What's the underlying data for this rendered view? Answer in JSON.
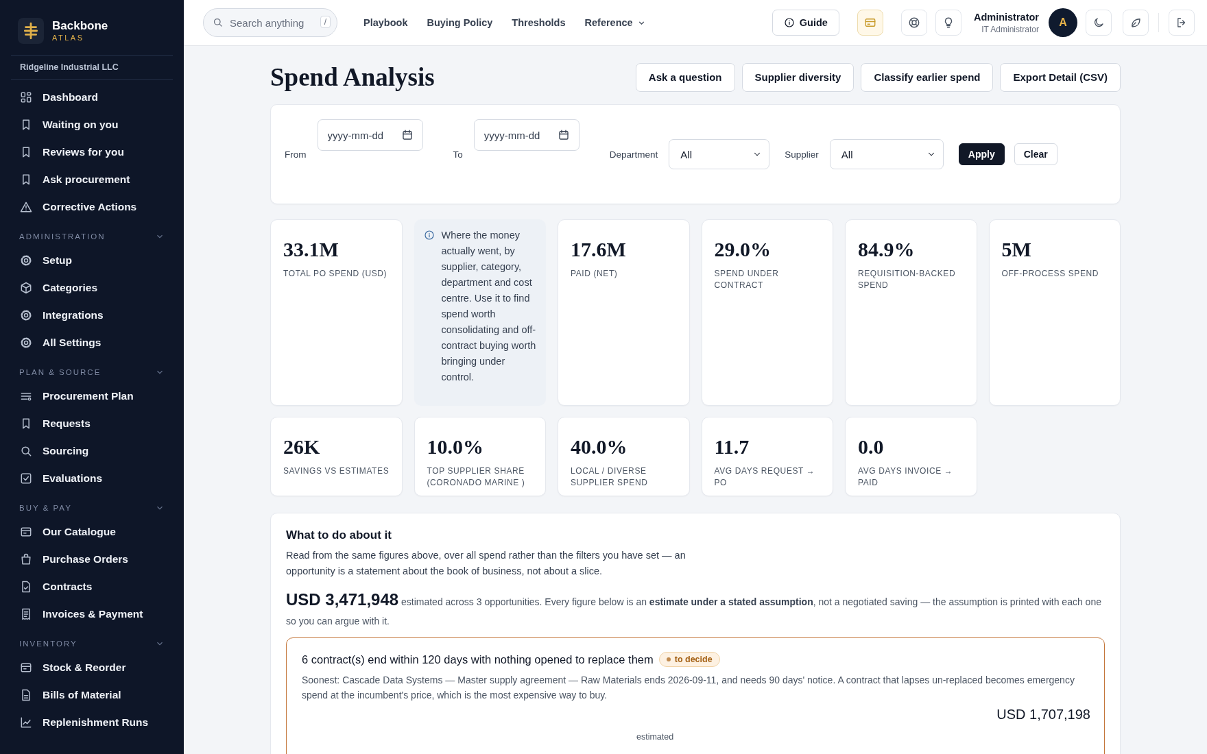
{
  "sidebar": {
    "brand": {
      "name": "Backbone",
      "tagline": "ATLAS"
    },
    "organization": "Ridgeline Industrial LLC",
    "items": [
      "Dashboard",
      "Waiting on you",
      "Reviews for you",
      "Ask procurement",
      "Corrective Actions"
    ],
    "sections": [
      {
        "title": "ADMINISTRATION",
        "expanded": true,
        "items": [
          "Setup",
          "Categories",
          "Integrations",
          "All Settings"
        ]
      },
      {
        "title": "PLAN & SOURCE",
        "expanded": true,
        "items": [
          "Procurement Plan",
          "Requests",
          "Sourcing",
          "Evaluations"
        ]
      },
      {
        "title": "BUY & PAY",
        "expanded": true,
        "items": [
          "Our Catalogue",
          "Purchase Orders",
          "Contracts",
          "Invoices & Payment"
        ]
      },
      {
        "title": "INVENTORY",
        "expanded": true,
        "items": [
          "Stock & Reorder",
          "Bills of Material",
          "Replenishment Runs"
        ]
      }
    ]
  },
  "topbar": {
    "search": {
      "placeholder": "Search anything",
      "shortcut": "/"
    },
    "nav": [
      {
        "label": "Playbook",
        "dropdown": false
      },
      {
        "label": "Buying Policy",
        "dropdown": false
      },
      {
        "label": "Thresholds",
        "dropdown": false
      },
      {
        "label": "Reference",
        "dropdown": true
      }
    ],
    "guide": "Guide",
    "user": {
      "name": "Administrator",
      "role": "IT Administrator",
      "initial": "A"
    }
  },
  "page": {
    "title": "Spend Analysis",
    "actions": [
      "Ask a question",
      "Supplier diversity",
      "Classify earlier spend",
      "Export Detail (CSV)"
    ]
  },
  "filters": {
    "dates": [
      {
        "label": "From",
        "placeholder": "yyyy-mm-dd"
      },
      {
        "label": "To",
        "placeholder": "yyyy-mm-dd"
      }
    ],
    "selects": [
      {
        "label": "Department",
        "value": "All"
      },
      {
        "label": "Supplier",
        "value": "All"
      }
    ],
    "buttons": [
      {
        "label": "Apply",
        "kind": "primary"
      },
      {
        "label": "Clear",
        "kind": "secondary"
      }
    ]
  },
  "stat_rows": [
    {
      "cards": [
        {
          "kind": "stat",
          "value": "33.1M",
          "label": "TOTAL PO SPEND (USD)"
        },
        {
          "kind": "note",
          "text": "Where the money actually went, by supplier, category, department and cost centre. Use it to find spend worth consolidating and off-contract buying worth bringing under control."
        },
        {
          "kind": "stat",
          "value": "17.6M",
          "label": "PAID (NET)"
        },
        {
          "kind": "stat",
          "value": "29.0%",
          "label": "SPEND UNDER CONTRACT"
        },
        {
          "kind": "stat",
          "value": "84.9%",
          "label": "REQUISITION-BACKED SPEND"
        },
        {
          "kind": "stat",
          "value": "5M",
          "label": "OFF-PROCESS SPEND"
        }
      ]
    },
    {
      "cards": [
        {
          "kind": "stat",
          "value": "26K",
          "label": "SAVINGS VS ESTIMATES"
        },
        {
          "kind": "stat",
          "value": "10.0%",
          "label": "TOP SUPPLIER SHARE (CORONADO MARINE )"
        },
        {
          "kind": "stat",
          "value": "40.0%",
          "label": "LOCAL / DIVERSE SUPPLIER SPEND"
        },
        {
          "kind": "stat",
          "value": "11.7",
          "label": "AVG DAYS REQUEST → PO"
        },
        {
          "kind": "stat",
          "value": "0.0",
          "label": "AVG DAYS INVOICE → PAID"
        }
      ]
    }
  ],
  "opportunities": {
    "title": "What to do about it",
    "intro": "Read from the same figures above, over all spend rather than the filters you have set — an opportunity is a statement about the book of business, not about a slice.",
    "total": "USD 3,471,948",
    "summary": "estimated across 3 opportunities. Every figure below is an **estimate under a stated assumption**, not a negotiated saving — the assumption is printed with each one so you can argue with it.",
    "items": [
      {
        "title": "6 contract(s) end within 120 days with nothing opened to replace them",
        "badge": "to decide",
        "detail": "Soonest: Cascade Data Systems — Master supply agreement — Raw Materials ends 2026-09-11, and needs 90 days' notice. A contract that lapses un-replaced becomes emergency spend at the incumbent's price, which is the most expensive way to buy.",
        "amount": "USD 1,707,198",
        "amount_note": "estimated"
      }
    ]
  }
}
